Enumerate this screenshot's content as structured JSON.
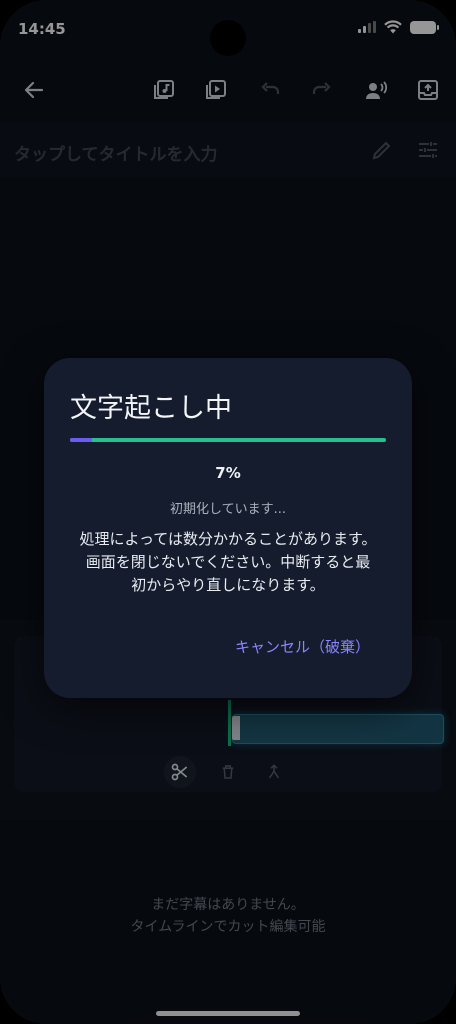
{
  "status_bar": {
    "time": "14:45"
  },
  "toolbar": {
    "icons": [
      "back-arrow-icon",
      "audio-file-icon",
      "video-file-icon",
      "undo-icon",
      "redo-icon",
      "voice-icon",
      "export-icon"
    ]
  },
  "title_row": {
    "title_placeholder": "タップしてタイトルを入力"
  },
  "empty_state": {
    "line1": "まだ字幕はありません。",
    "line2": "タイムラインでカット編集可能"
  },
  "dialog": {
    "title": "文字起こし中",
    "progress_fraction": 0.07,
    "percent_text": "7%",
    "stage_text": "初期化しています...",
    "message_line1": "処理によっては数分かかることがあります。",
    "message_line2": "画面を閉じないでください。中断すると最",
    "message_line3": "初からやり直しになります。",
    "cancel_label": "キャンセル（破棄）"
  },
  "colors": {
    "background": "#0b0f17",
    "dialog_bg": "#141c2e",
    "accent_purple": "#6a5cf0",
    "accent_green": "#28c08e",
    "cancel_text": "#8b83ff"
  }
}
